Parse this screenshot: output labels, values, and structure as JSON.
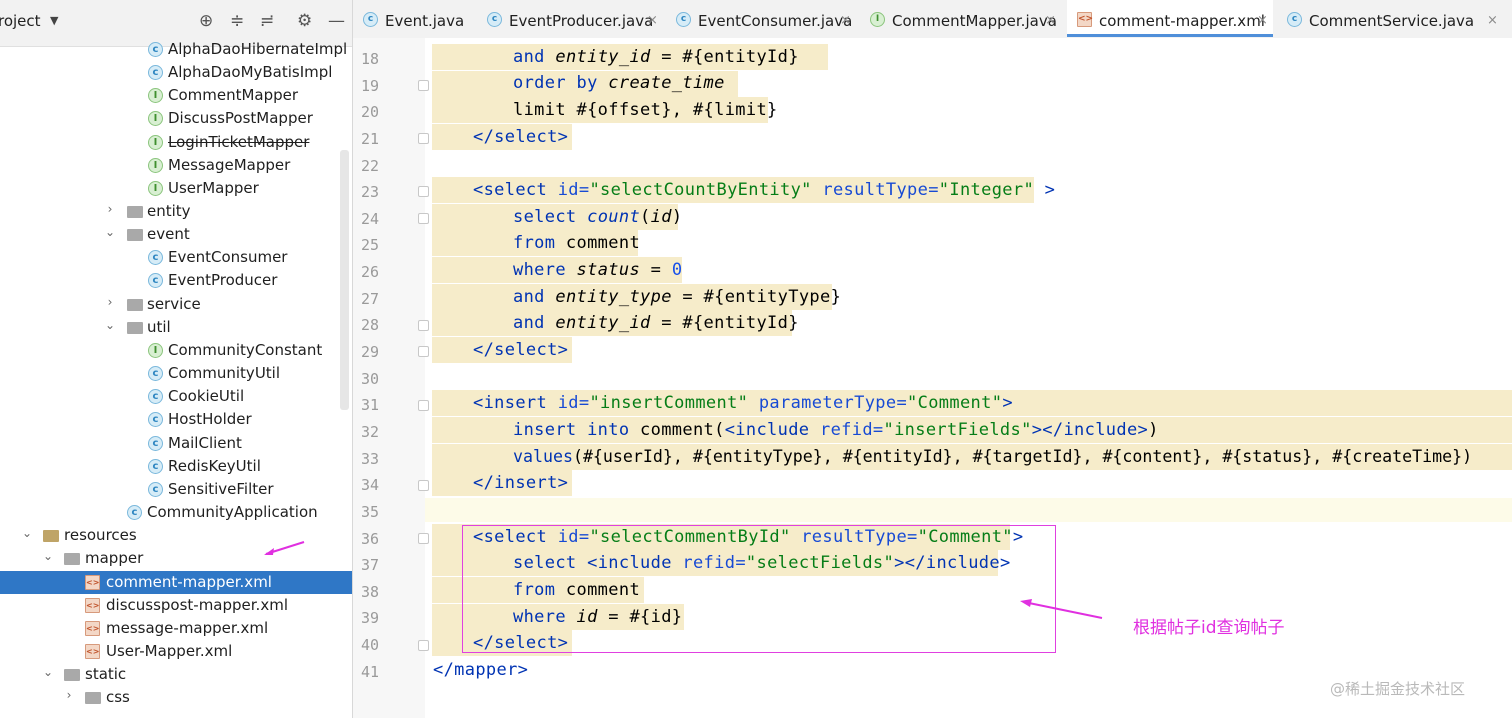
{
  "project_panel": {
    "title": "roject",
    "dropdown_icon": "caret-down-icon",
    "header_icons": [
      "crosshair-icon",
      "expand-all-icon",
      "collapse-all-icon",
      "gear-icon",
      "minimize-icon"
    ],
    "tree": [
      {
        "label": "AlphaDaoHibernateImpl",
        "icon": "class-icon",
        "struck": false
      },
      {
        "label": "AlphaDaoMyBatisImpl",
        "icon": "class-icon",
        "struck": false
      },
      {
        "label": "CommentMapper",
        "icon": "interface-icon",
        "struck": false
      },
      {
        "label": "DiscussPostMapper",
        "icon": "interface-icon",
        "struck": false
      },
      {
        "label": "LoginTicketMapper",
        "icon": "interface-icon",
        "struck": true
      },
      {
        "label": "MessageMapper",
        "icon": "interface-icon",
        "struck": false
      },
      {
        "label": "UserMapper",
        "icon": "interface-icon",
        "struck": false
      },
      {
        "label": "entity",
        "icon": "folder-icon",
        "expanded": false
      },
      {
        "label": "event",
        "icon": "folder-icon",
        "expanded": true
      },
      {
        "label": "EventConsumer",
        "icon": "class-icon",
        "struck": false
      },
      {
        "label": "EventProducer",
        "icon": "class-icon",
        "struck": false
      },
      {
        "label": "service",
        "icon": "folder-icon",
        "expanded": false
      },
      {
        "label": "util",
        "icon": "folder-icon",
        "expanded": true
      },
      {
        "label": "CommunityConstant",
        "icon": "interface-icon",
        "struck": false
      },
      {
        "label": "CommunityUtil",
        "icon": "class-icon",
        "struck": false
      },
      {
        "label": "CookieUtil",
        "icon": "class-icon",
        "struck": false
      },
      {
        "label": "HostHolder",
        "icon": "class-icon",
        "struck": false
      },
      {
        "label": "MailClient",
        "icon": "class-icon",
        "struck": false
      },
      {
        "label": "RedisKeyUtil",
        "icon": "class-icon",
        "struck": false
      },
      {
        "label": "SensitiveFilter",
        "icon": "class-icon",
        "struck": false
      },
      {
        "label": "CommunityApplication",
        "icon": "spring-app-icon",
        "struck": false
      },
      {
        "label": "resources",
        "icon": "resources-folder-icon",
        "expanded": true
      },
      {
        "label": "mapper",
        "icon": "folder-icon",
        "expanded": true
      },
      {
        "label": "comment-mapper.xml",
        "icon": "xml-file-icon",
        "selected": true
      },
      {
        "label": "discusspost-mapper.xml",
        "icon": "xml-file-icon"
      },
      {
        "label": "message-mapper.xml",
        "icon": "xml-file-icon"
      },
      {
        "label": "User-Mapper.xml",
        "icon": "xml-file-icon"
      },
      {
        "label": "static",
        "icon": "folder-icon",
        "expanded": true
      },
      {
        "label": "css",
        "icon": "folder-icon",
        "expanded": false
      }
    ]
  },
  "tabs": [
    {
      "label": "Event.java",
      "icon": "class-icon"
    },
    {
      "label": "EventProducer.java",
      "icon": "class-icon"
    },
    {
      "label": "EventConsumer.java",
      "icon": "class-icon"
    },
    {
      "label": "CommentMapper.java",
      "icon": "interface-icon"
    },
    {
      "label": "comment-mapper.xml",
      "icon": "xml-file-icon",
      "active": true
    },
    {
      "label": "CommentService.java",
      "icon": "class-icon"
    }
  ],
  "editor": {
    "line_numbers": [
      "18",
      "19",
      "20",
      "21",
      "22",
      "23",
      "24",
      "25",
      "26",
      "27",
      "28",
      "29",
      "30",
      "31",
      "32",
      "33",
      "34",
      "35",
      "36",
      "37",
      "38",
      "39",
      "40",
      "41"
    ],
    "lines": {
      "l18": {
        "kw": "and",
        "it": "entity_id",
        "rest": " = #{entityId}"
      },
      "l19": {
        "kw": "order by",
        "it": "create_time"
      },
      "l20": {
        "text": "limit #{offset}, #{limit}"
      },
      "l21": {
        "text": "</select>"
      },
      "l23": {
        "tag": "<select",
        "a1": "id=",
        "v1": "\"selectCountByEntity\"",
        "a2": "resultType=",
        "v2": "\"Integer\"",
        "end": " >"
      },
      "l24": {
        "kw": "select",
        "it": "count",
        "rest": "(",
        "it2": "id",
        "rest2": ")"
      },
      "l25": {
        "kw": "from",
        "rest": " comment"
      },
      "l26": {
        "kw": "where",
        "it": "status",
        "rest": " = ",
        "num": "0"
      },
      "l27": {
        "kw": "and",
        "it": "entity_type",
        "rest": " = #{entityType}"
      },
      "l28": {
        "kw": "and",
        "it": "entity_id",
        "rest": " = #{entityId}"
      },
      "l29": {
        "text": "</select>"
      },
      "l31": {
        "tag": "<insert",
        "a1": "id=",
        "v1": "\"insertComment\"",
        "a2": "parameterType=",
        "v2": "\"Comment\"",
        "end": ">"
      },
      "l32": {
        "kw": "insert into",
        "rest": " comment(",
        "tag": "<include",
        "a1": "refid=",
        "v1": "\"insertFields\"",
        "end": "></include>",
        "rest2": ")"
      },
      "l33": {
        "kw": "values",
        "rest": "(#{userId}, #{entityType}, #{entityId}, #{targetId}, #{content}, #{status}, #{createTime})"
      },
      "l34": {
        "text": "</insert>"
      },
      "l36": {
        "tag": "<select",
        "a1": "id=",
        "v1": "\"selectCommentById\"",
        "a2": "resultType=",
        "v2": "\"Comment\"",
        "end": ">"
      },
      "l37": {
        "kw": "select",
        "tag": "<include",
        "a1": "refid=",
        "v1": "\"selectFields\"",
        "end": "></include>"
      },
      "l38": {
        "kw": "from",
        "rest": " comment"
      },
      "l39": {
        "kw": "where",
        "it": "id",
        "rest": " = #{id}"
      },
      "l40": {
        "text": "</select>"
      },
      "l41": {
        "text": "</mapper>"
      }
    }
  },
  "annotation": {
    "text": "根据帖子id查询帖子",
    "color": "#e030e0"
  },
  "watermark": "@稀土掘金技术社区"
}
